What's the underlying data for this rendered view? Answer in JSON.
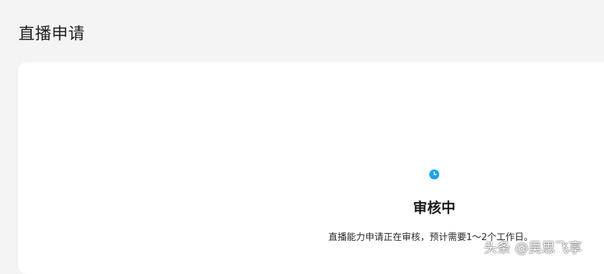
{
  "page": {
    "title": "直播申请"
  },
  "status": {
    "icon": "clock-icon",
    "title": "审核中",
    "description": "直播能力申请正在审核，预计需要1～2个工作日。"
  },
  "watermark": {
    "text": "头条 @吴思飞享"
  },
  "colors": {
    "background": "#f4f4f4",
    "card": "#ffffff",
    "accent": "#1aa3e8"
  }
}
